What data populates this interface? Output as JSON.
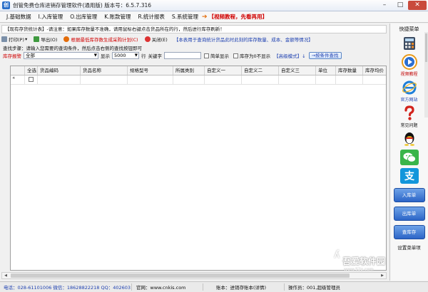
{
  "window": {
    "title": "创管免费仓库进销存管理软件(通用版)  版本号：6.5.7.316",
    "app_icon_glyph": "创",
    "controls": {
      "minimize": "–",
      "maximize": "□",
      "close": "✕"
    }
  },
  "menu": [
    "J.基础数据",
    "I.入库管理",
    "O.出库管理",
    "K.账款管理",
    "R.统计报表",
    "S.系统管理"
  ],
  "menu_tutorial": "【视频教程，先看再用】",
  "info_text": "【现有存货统计表】-请注意：如果库存数量不准确，请用鼠标右键点击货品所在的行，然后进行库存刷新！",
  "toolbar": {
    "print": "打印(P)",
    "print_arrow": "▾",
    "export": "导出(O)",
    "plan": "根据最低库存数生成采购计划(C)",
    "close": "关闭(E)",
    "note": "【本表用于查询统计货品此时此刻的库存数量、成本、金额等情况】"
  },
  "steps_text": "查找步骤：请输入您需要的查询条件，然后点击右侧的查找按钮即可",
  "filter": {
    "warning_label": "库存报警",
    "warning_value": "全部",
    "show_label": "显示",
    "show_value": "5000",
    "row_label": "行",
    "keyword_label": "关键字",
    "keyword_value": "",
    "simple_label": "简单显示",
    "zero_label": "库存为0不显示",
    "advanced_label": "【高级模式】",
    "advanced_arrow": "↓",
    "search_button": "→按条件查找"
  },
  "grid": {
    "columns": [
      "全选",
      "货品编码",
      "货品名称",
      "规格型号",
      "所属类别",
      "自定义一",
      "自定义二",
      "自定义三",
      "单位",
      "库存数量",
      "库存均价"
    ],
    "row_marker": "✳"
  },
  "scrollbar": {
    "left": "◀",
    "right": "▶"
  },
  "status": {
    "phone": "电话：028-61101006  微信：18628822218  QQ：402603",
    "website": "官网：www.cnkis.com",
    "account": "账本：进销存账本(详情)",
    "operator": "操作员：001,超级管理员"
  },
  "sidebar": {
    "title": "快捷菜单",
    "calculator_label": "计算器",
    "video_label": "视频教程",
    "website_label": "官方网站",
    "faq_label": "常见问题",
    "qq_label": "QQ",
    "wechat_label": "微信",
    "alipay_label": "支付宝",
    "buttons": [
      "入库单",
      "出库单",
      "查库存"
    ],
    "settings_label": "设置菜单项"
  },
  "watermark": {
    "mark": "ʎ",
    "main": "吾爱软件园",
    "sub": "www.52z.com"
  },
  "colors": {
    "accent_blue": "#1c3fb0",
    "alert_red": "#d00000",
    "button_blue": "#2c65c7"
  }
}
